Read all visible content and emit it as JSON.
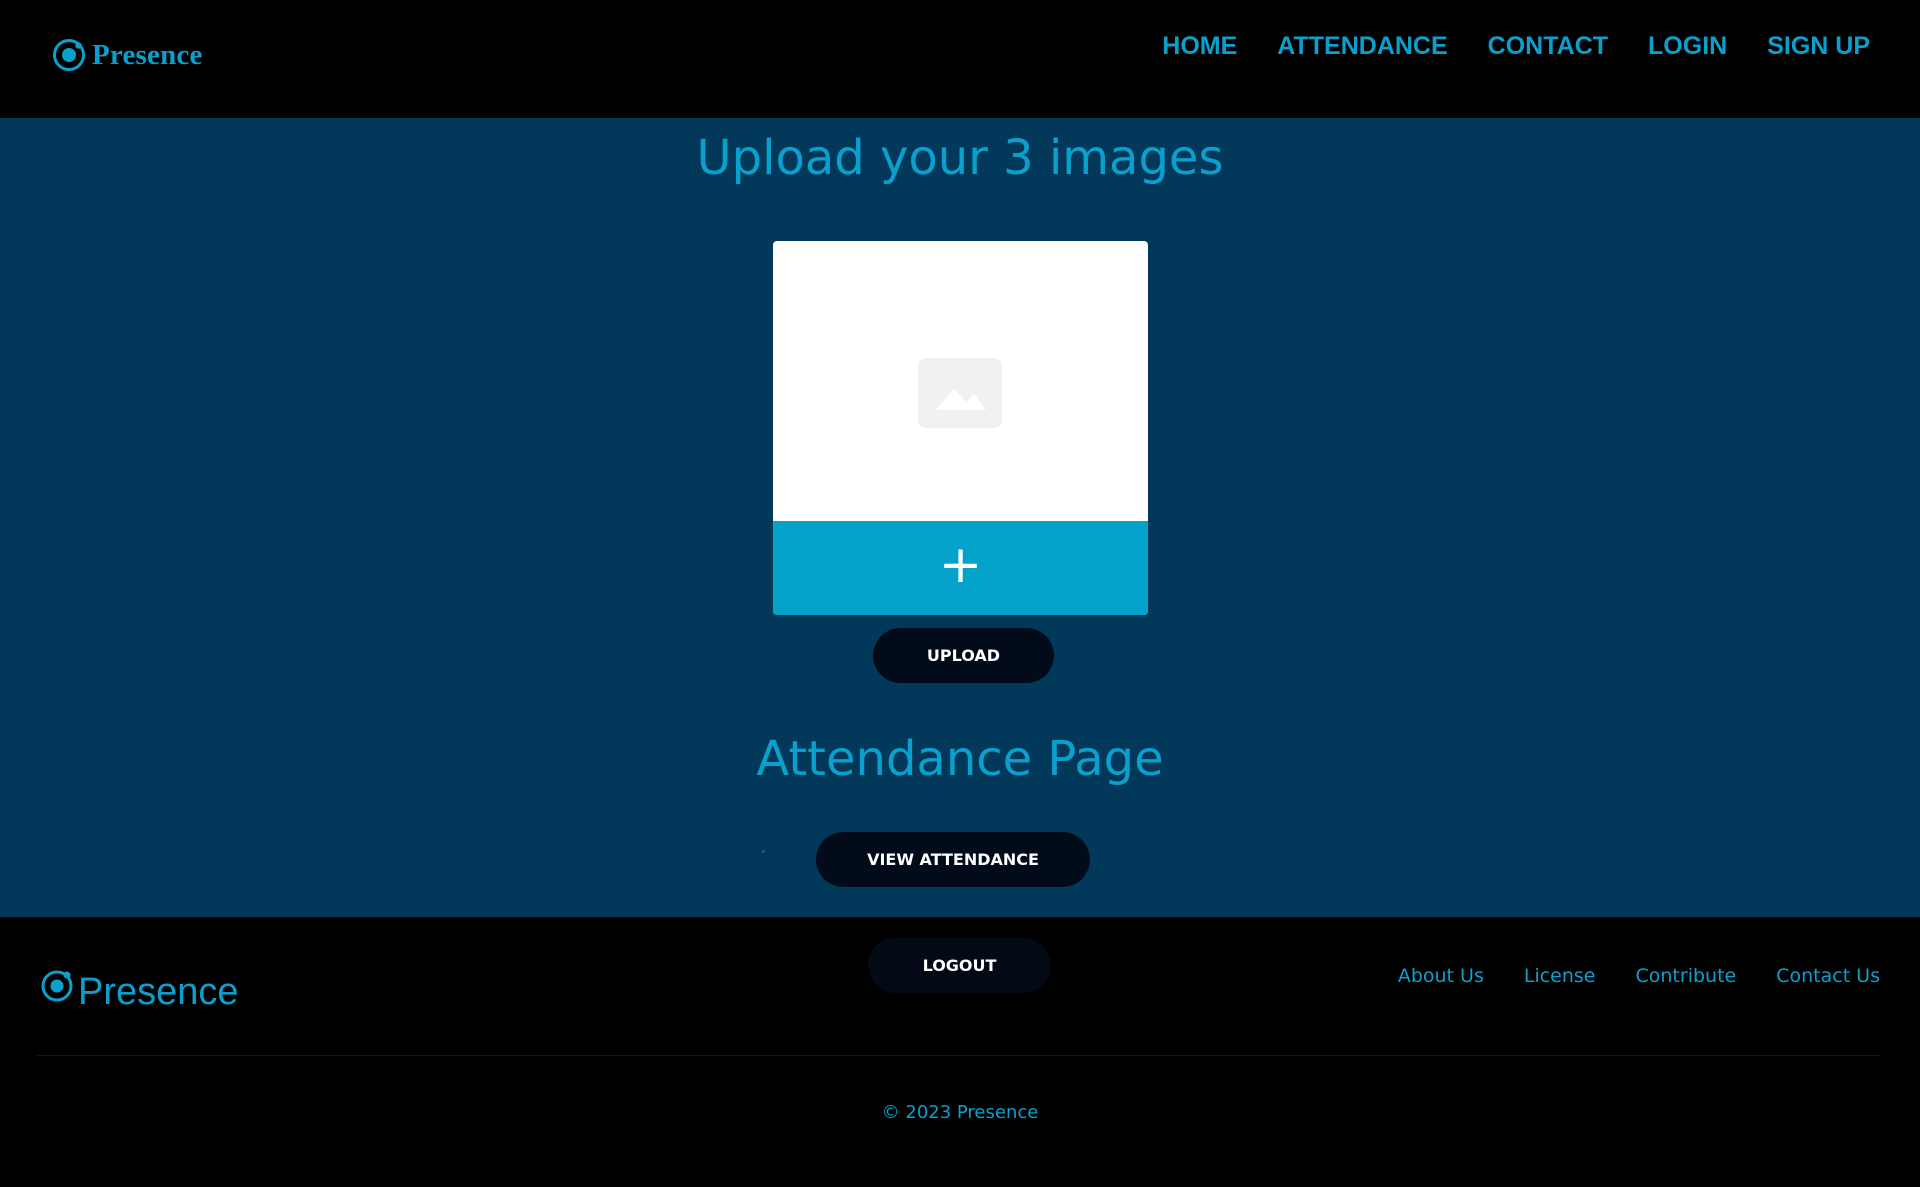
{
  "header": {
    "brand_name": "Presence",
    "nav": [
      {
        "label": "HOME"
      },
      {
        "label": "ATTENDANCE"
      },
      {
        "label": "CONTACT"
      },
      {
        "label": "LOGIN"
      },
      {
        "label": "SIGN UP"
      }
    ]
  },
  "main": {
    "upload_title": "Upload your 3 images",
    "add_icon": "+",
    "upload_button": "UPLOAD",
    "attendance_title": "Attendance Page",
    "view_button": "VIEW ATTENDANCE",
    "logout_button": "LOGOUT"
  },
  "footer": {
    "brand_name": "Presence",
    "links": [
      {
        "label": "About Us"
      },
      {
        "label": "License"
      },
      {
        "label": "Contribute"
      },
      {
        "label": "Contact Us"
      }
    ],
    "copyright": "© 2023 Presence"
  },
  "icons": {
    "brand_logo": "ionic-logo-icon",
    "placeholder": "image-placeholder-icon",
    "add": "plus-icon"
  },
  "colors": {
    "accent": "#0aa0cd",
    "page_background": "#02385a",
    "header_background": "#000000",
    "add_bar": "#04a2ca",
    "button_background": "#020b1a"
  }
}
